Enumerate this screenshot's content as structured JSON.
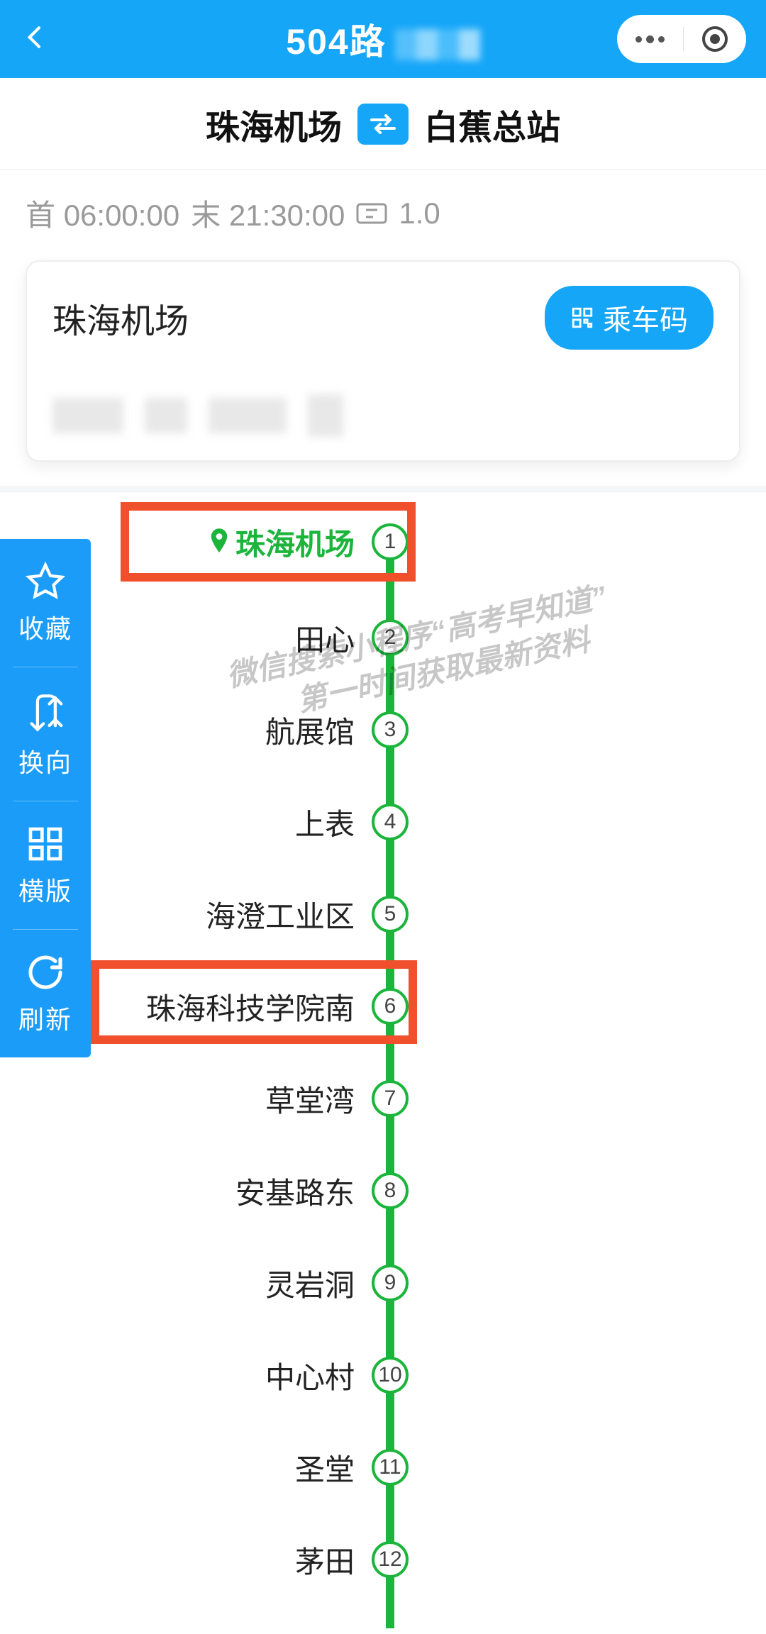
{
  "header": {
    "title": "504路"
  },
  "route": {
    "from": "珠海机场",
    "to": "白蕉总站"
  },
  "info": {
    "first_label": "首",
    "first_time": "06:00:00",
    "last_label": "末",
    "last_time": "21:30:00",
    "fare": "1.0"
  },
  "card": {
    "station": "珠海机场",
    "qr_label": "乘车码"
  },
  "stops": [
    {
      "name": "珠海机场",
      "num": "1",
      "current": true,
      "highlight": true
    },
    {
      "name": "田心",
      "num": "2"
    },
    {
      "name": "航展馆",
      "num": "3"
    },
    {
      "name": "上表",
      "num": "4"
    },
    {
      "name": "海澄工业区",
      "num": "5"
    },
    {
      "name": "珠海科技学院南",
      "num": "6",
      "highlight": true
    },
    {
      "name": "草堂湾",
      "num": "7"
    },
    {
      "name": "安基路东",
      "num": "8"
    },
    {
      "name": "灵岩洞",
      "num": "9"
    },
    {
      "name": "中心村",
      "num": "10"
    },
    {
      "name": "圣堂",
      "num": "11"
    },
    {
      "name": "茅田",
      "num": "12"
    }
  ],
  "side": {
    "fav": "收藏",
    "reverse": "换向",
    "horiz": "横版",
    "refresh": "刷新"
  },
  "watermark": {
    "line1": "微信搜索小程序“高考早知道”",
    "line2": "第一时间获取最新资料"
  }
}
